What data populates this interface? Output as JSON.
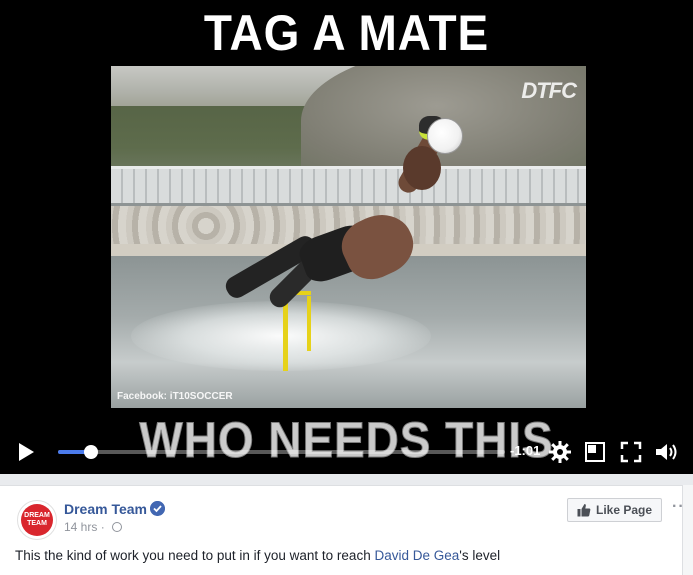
{
  "video": {
    "caption_top": "TAG A MATE",
    "caption_bottom": "WHO NEEDS THIS",
    "watermark": "DTFC",
    "frame_credit": "Facebook: iT10SOCCER",
    "time_remaining": "-1:01",
    "progress_fraction": 0.04,
    "accent_color": "#4b7bec"
  },
  "post": {
    "page_name": "Dream Team",
    "avatar_text": "DREAM TEAM",
    "time": "14 hrs",
    "separator": "·",
    "like_button": "Like Page",
    "more": "···",
    "text_before": "This the kind of work you need to put in if you want to reach ",
    "mention": "David De Gea",
    "text_after": "'s level",
    "link_color": "#365899"
  }
}
